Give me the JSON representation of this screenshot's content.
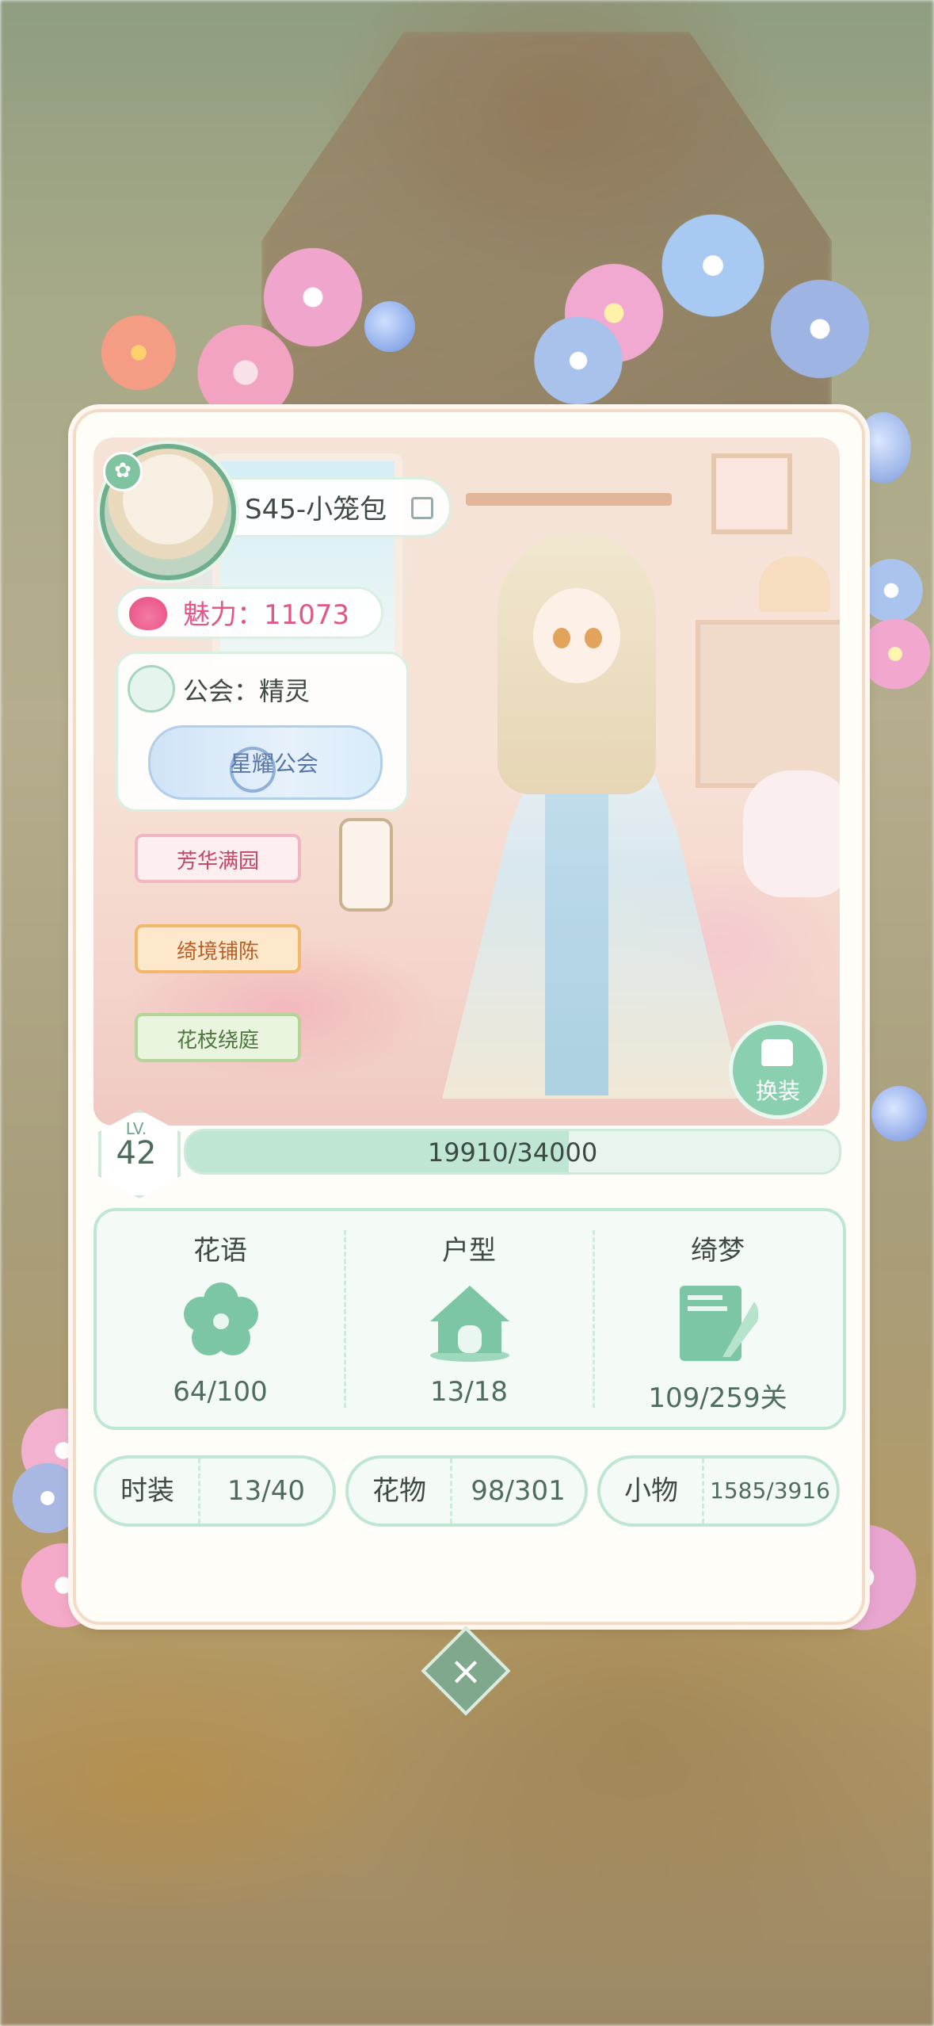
{
  "profile": {
    "name": "S45-小笼包",
    "charm_label": "魅力：11073",
    "guild_label": "公会：精灵",
    "guild_badge": "星耀公会",
    "titles": [
      "芳华满园",
      "绮境铺陈",
      "花枝绕庭"
    ],
    "outfit_button": "换装"
  },
  "level": {
    "lv_label": "LV.",
    "lv": "42",
    "xp_text": "19910/34000",
    "xp_fraction": 0.5856
  },
  "stats": [
    {
      "label": "花语",
      "value": "64/100",
      "icon": "flower-icon"
    },
    {
      "label": "户型",
      "value": "13/18",
      "icon": "house-icon"
    },
    {
      "label": "绮梦",
      "value": "109/259关",
      "icon": "letter-quill-icon"
    }
  ],
  "collections": [
    {
      "label": "时装",
      "value": "13/40"
    },
    {
      "label": "花物",
      "value": "98/301"
    },
    {
      "label": "小物",
      "value": "1585/3916"
    }
  ],
  "colors": {
    "accent_green": "#7fc3a0",
    "charm_pink": "#e1578a"
  }
}
